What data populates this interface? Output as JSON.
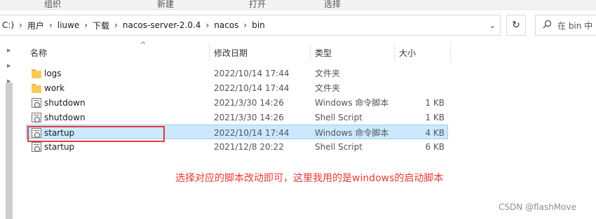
{
  "ribbon": {
    "groups": [
      "组织",
      "新建",
      "打开",
      "选择"
    ]
  },
  "address": {
    "crumbs": [
      "C:)",
      "用户",
      "liuwe",
      "下载",
      "nacos-server-2.0.4",
      "nacos",
      "bin"
    ],
    "separator": "›",
    "dropdown_glyph": "⌄",
    "refresh_glyph": "↻",
    "search_placeholder": "在 bin 中"
  },
  "columns": {
    "name": "名称",
    "modified": "修改日期",
    "type": "类型",
    "size": "大小"
  },
  "files": [
    {
      "icon": "folder-icon",
      "name": "logs",
      "modified": "2022/10/14 17:44",
      "type": "文件夹",
      "size": "",
      "selected": false
    },
    {
      "icon": "folder-icon",
      "name": "work",
      "modified": "2022/10/14 17:44",
      "type": "文件夹",
      "size": "",
      "selected": false
    },
    {
      "icon": "script-icon",
      "name": "shutdown",
      "modified": "2021/3/30 14:26",
      "type": "Windows 命令脚本",
      "size": "1 KB",
      "selected": false
    },
    {
      "icon": "script-icon",
      "name": "shutdown",
      "modified": "2021/3/30 14:26",
      "type": "Shell Script",
      "size": "1 KB",
      "selected": false
    },
    {
      "icon": "script-icon",
      "name": "startup",
      "modified": "2022/10/14 17:44",
      "type": "Windows 命令脚本",
      "size": "4 KB",
      "selected": true
    },
    {
      "icon": "script-icon",
      "name": "startup",
      "modified": "2021/12/8 20:22",
      "type": "Shell Script",
      "size": "6 KB",
      "selected": false
    }
  ],
  "annotation": "选择对应的脚本改动即可，这里我用的是windows的启动脚本",
  "watermark": "CSDN @flashMove",
  "colors": {
    "selection_bg": "#cce8ff",
    "selection_border": "#99d1ff",
    "annotation_red": "#e53935",
    "folder_yellow": "#f6ca5a"
  }
}
